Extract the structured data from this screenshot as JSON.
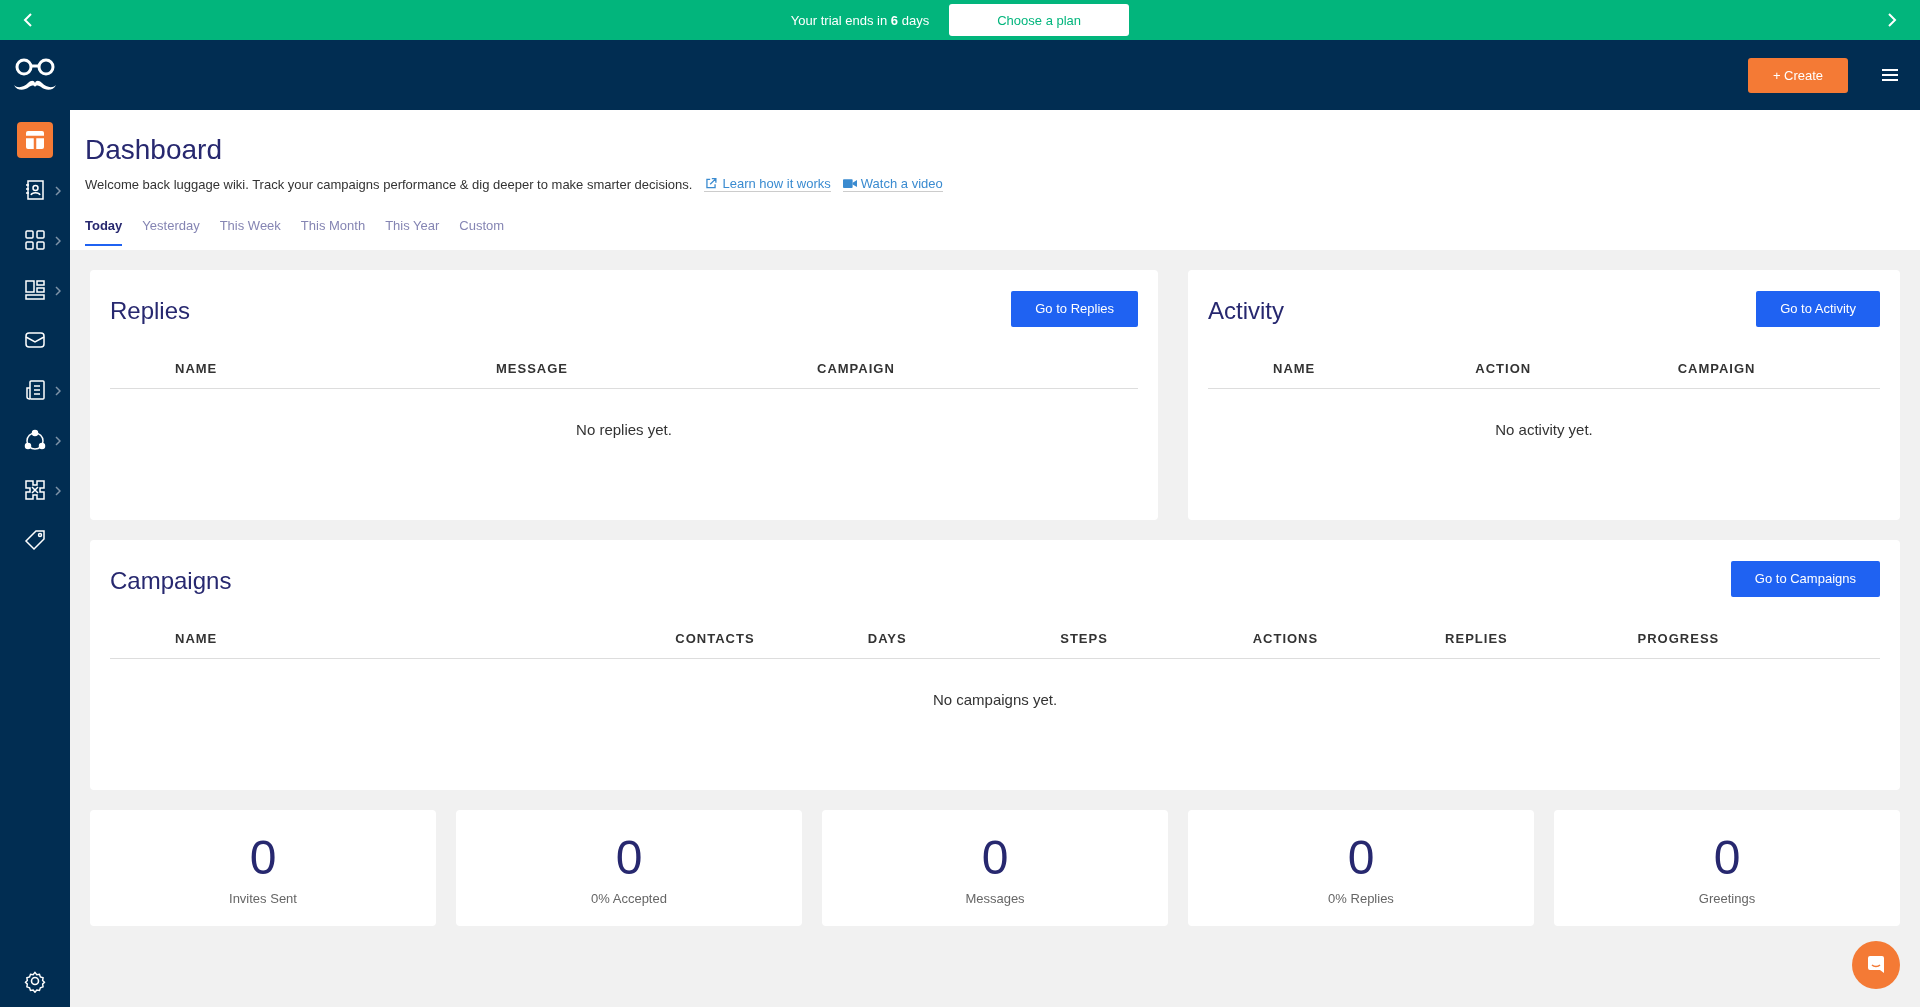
{
  "trial_banner": {
    "text": "Your trial ends in **6** days",
    "button": "Choose a plan"
  },
  "header": {
    "create_button": "+ Create"
  },
  "sidebar": {
    "items": [
      {
        "selected": true,
        "expandable": false
      },
      {
        "selected": false,
        "expandable": true
      },
      {
        "selected": false,
        "expandable": true
      },
      {
        "selected": false,
        "expandable": true
      },
      {
        "selected": false,
        "expandable": false
      },
      {
        "selected": false,
        "expandable": true
      },
      {
        "selected": false,
        "expandable": true
      },
      {
        "selected": false,
        "expandable": true
      },
      {
        "selected": false,
        "expandable": false
      }
    ]
  },
  "page": {
    "title": "Dashboard",
    "welcome": "Welcome back luggage wiki. Track your campaigns performance & dig deeper to make smarter decisions.",
    "learn_link": "Learn how it works",
    "video_link": "Watch a video"
  },
  "tabs": [
    {
      "label": "Today",
      "selected": true
    },
    {
      "label": "Yesterday",
      "selected": false
    },
    {
      "label": "This Week",
      "selected": false
    },
    {
      "label": "This Month",
      "selected": false
    },
    {
      "label": "This Year",
      "selected": false
    },
    {
      "label": "Custom",
      "selected": false
    }
  ],
  "replies": {
    "title": "Replies",
    "button": "Go to Replies",
    "columns": [
      "NAME",
      "MESSAGE",
      "CAMPAIGN"
    ],
    "empty": "No replies yet."
  },
  "activity": {
    "title": "Activity",
    "button": "Go to Activity",
    "columns": [
      "NAME",
      "ACTION",
      "CAMPAIGN"
    ],
    "empty": "No activity yet."
  },
  "campaigns": {
    "title": "Campaigns",
    "button": "Go to Campaigns",
    "columns": [
      "NAME",
      "CONTACTS",
      "DAYS",
      "STEPS",
      "ACTIONS",
      "REPLIES",
      "PROGRESS"
    ],
    "empty": "No campaigns yet."
  },
  "stats": [
    {
      "value": "0",
      "label": "Invites Sent"
    },
    {
      "value": "0",
      "label": "0% Accepted"
    },
    {
      "value": "0",
      "label": "Messages"
    },
    {
      "value": "0",
      "label": "0% Replies"
    },
    {
      "value": "0",
      "label": "Greetings"
    }
  ]
}
